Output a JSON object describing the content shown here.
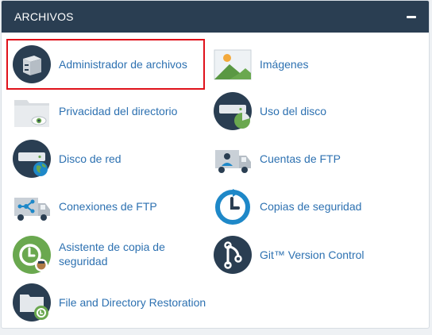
{
  "panel": {
    "title": "ARCHIVOS",
    "collapse_symbol": "−"
  },
  "items": [
    {
      "label": "Administrador de archivos",
      "icon": "file-manager-icon",
      "highlighted": true
    },
    {
      "label": "Imágenes",
      "icon": "images-icon"
    },
    {
      "label": "Privacidad del directorio",
      "icon": "directory-privacy-icon"
    },
    {
      "label": "Uso del disco",
      "icon": "disk-usage-icon"
    },
    {
      "label": "Disco de red",
      "icon": "web-disk-icon"
    },
    {
      "label": "Cuentas de FTP",
      "icon": "ftp-accounts-icon"
    },
    {
      "label": "Conexiones de FTP",
      "icon": "ftp-connections-icon"
    },
    {
      "label": "Copias de seguridad",
      "icon": "backup-icon"
    },
    {
      "label": "Asistente de copia de seguridad",
      "icon": "backup-wizard-icon"
    },
    {
      "label": "Git™ Version Control",
      "icon": "git-icon"
    },
    {
      "label": "File and Directory Restoration",
      "icon": "file-restoration-icon"
    }
  ],
  "colors": {
    "header": "#2a3e52",
    "link": "#2d71b1",
    "highlight": "#e0121b",
    "icon_dark": "#2a3e52",
    "icon_blue": "#1e88c8",
    "icon_green": "#6aa84f"
  }
}
